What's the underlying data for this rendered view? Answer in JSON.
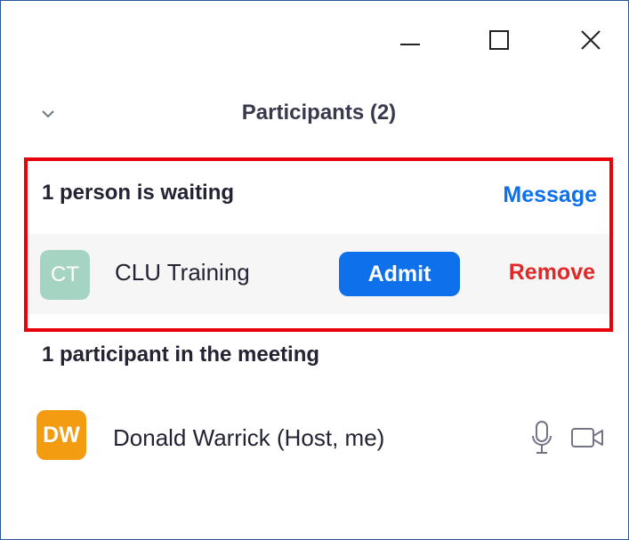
{
  "window": {
    "controls": [
      "minimize",
      "maximize",
      "close"
    ]
  },
  "header": {
    "title": "Participants (2)"
  },
  "waiting": {
    "title": "1 person is waiting",
    "message_label": "Message",
    "person": {
      "initials": "CT",
      "name": "CLU Training",
      "avatar_color": "#a6d4c3"
    },
    "admit_label": "Admit",
    "remove_label": "Remove"
  },
  "meeting": {
    "title": "1 participant in the meeting",
    "participants": [
      {
        "initials": "DW",
        "name": "Donald Warrick (Host, me)",
        "avatar_color": "#f39b11",
        "icons": [
          "microphone-icon",
          "video-camera-icon"
        ]
      }
    ]
  },
  "colors": {
    "accent": "#0e71eb",
    "remove": "#e02828",
    "highlight_border": "#e8000b"
  }
}
